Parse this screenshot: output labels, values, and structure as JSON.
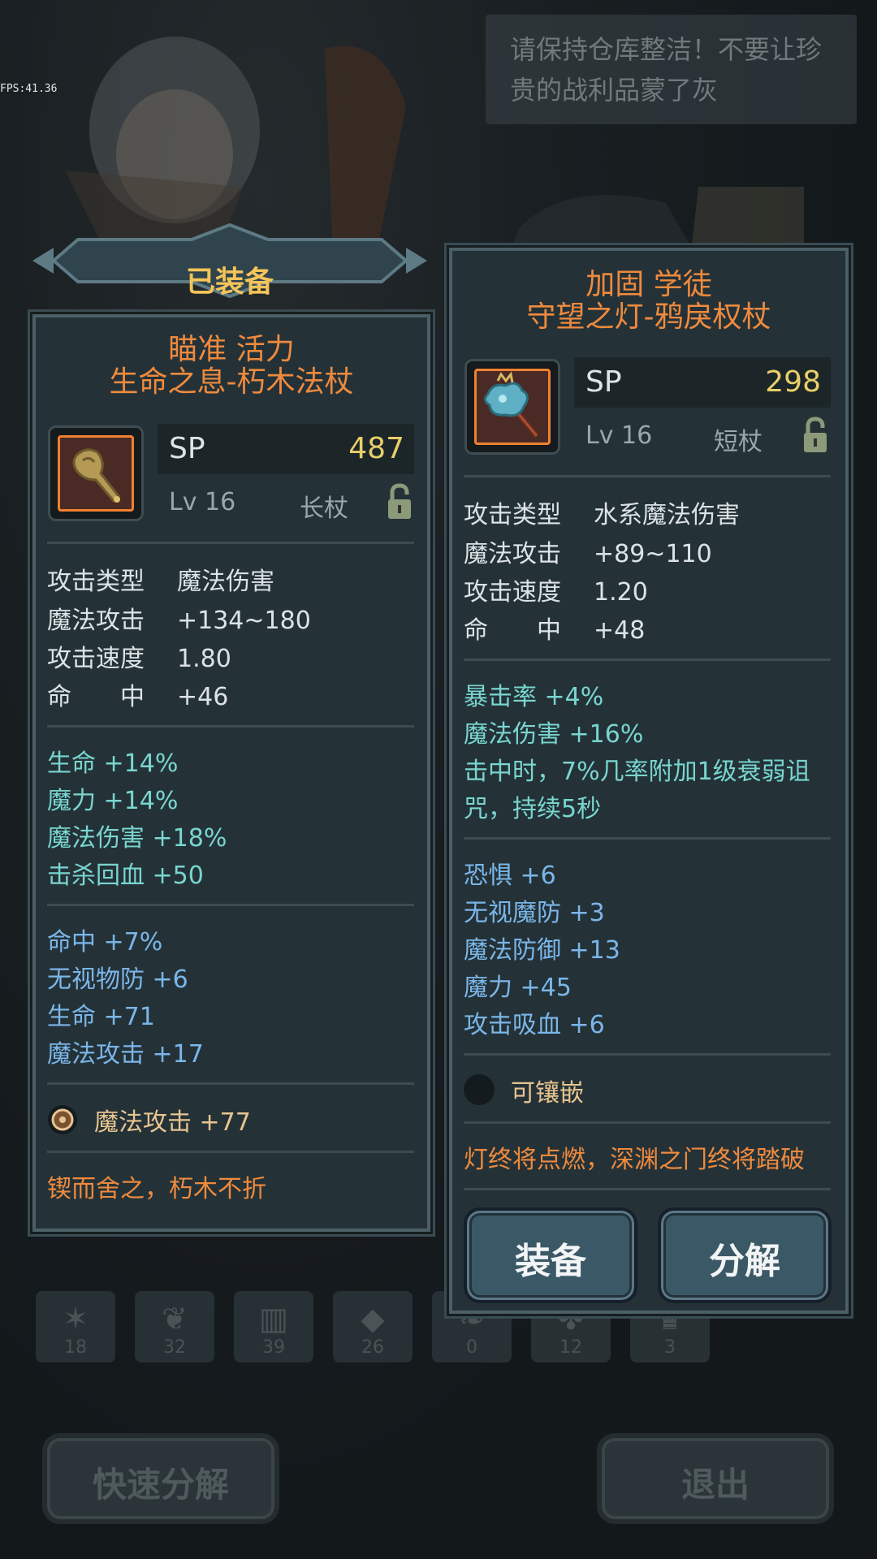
{
  "fps": "FPS:41.36",
  "speech": "请保持仓库整洁！不要让珍贵的战利品蒙了灰",
  "equipped_banner": "已装备",
  "left_item": {
    "affix": "瞄准 活力",
    "name": "生命之息-朽木法杖",
    "icon": "wooden-staff-icon",
    "sp_label": "SP",
    "sp_value": "487",
    "level": "Lv 16",
    "type": "长杖",
    "base": [
      {
        "k": "攻击类型",
        "v": "魔法伤害"
      },
      {
        "k": "魔法攻击",
        "v": "+134~180"
      },
      {
        "k": "攻击速度",
        "v": "1.80"
      },
      {
        "k": "命　　中",
        "v": "+46"
      }
    ],
    "teal": [
      "生命 +14%",
      "魔力 +14%",
      "魔法伤害 +18%",
      "击杀回血 +50"
    ],
    "blue": [
      "命中 +7%",
      "无视物防 +6",
      "生命 +71",
      "魔法攻击 +17"
    ],
    "gem": "魔法攻击 +77",
    "flavor": "锲而舍之，朽木不折"
  },
  "right_item": {
    "affix": "加固 学徒",
    "name": "守望之灯-鸦戾权杖",
    "icon": "crystal-scepter-icon",
    "sp_label": "SP",
    "sp_value": "298",
    "level": "Lv 16",
    "type": "短杖",
    "base": [
      {
        "k": "攻击类型",
        "v": "水系魔法伤害"
      },
      {
        "k": "魔法攻击",
        "v": "+89~110"
      },
      {
        "k": "攻击速度",
        "v": "1.20"
      },
      {
        "k": "命　　中",
        "v": "+48"
      }
    ],
    "teal": [
      "暴击率 +4%",
      "魔法伤害 +16%",
      "击中时，7%几率附加1级衰弱诅",
      "咒，持续5秒"
    ],
    "blue": [
      "恐惧 +6",
      "无视魔防 +3",
      "魔法防御 +13",
      "魔力 +45",
      "攻击吸血 +6"
    ],
    "socket": "可镶嵌",
    "flavor": "灯终将点燃，深渊之门终将踏破",
    "equip_button": "装备",
    "dismantle_button": "分解"
  },
  "tabs": [
    "18",
    "32",
    "39",
    "26",
    "0",
    "12",
    "3"
  ],
  "quick_dismantle": "快速分解",
  "exit": "退出"
}
